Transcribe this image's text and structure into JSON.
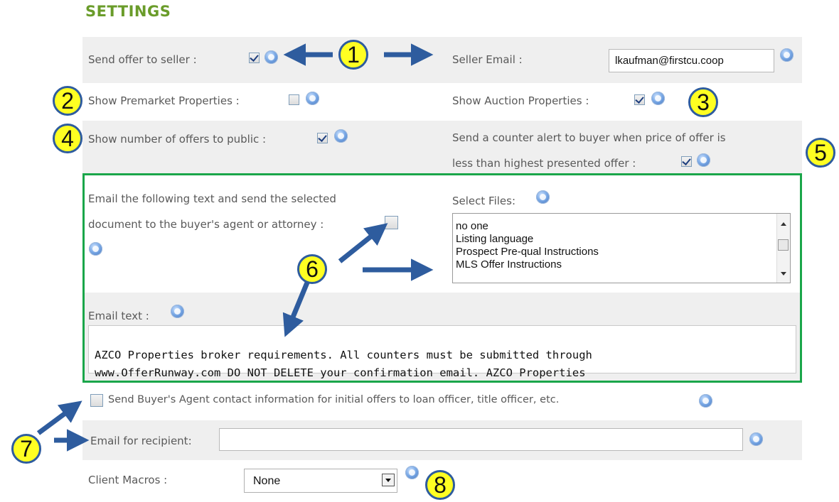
{
  "title": "SETTINGS",
  "send_offer": {
    "label": "Send offer to seller :",
    "checked": true
  },
  "seller_email": {
    "label": "Seller Email :",
    "value": "lkaufman@firstcu.coop"
  },
  "premarket": {
    "label": "Show Premarket Properties :",
    "checked": false
  },
  "auction": {
    "label": "Show Auction Properties :",
    "checked": true
  },
  "num_offers": {
    "label": "Show number of offers to public :",
    "checked": true
  },
  "counter_alert": {
    "label_line1": "Send a counter alert to buyer when price of offer is",
    "label_line2": "less than highest presented offer :",
    "checked": true
  },
  "email_doc": {
    "label_line1": "Email the following text and send the selected",
    "label_line2": "document to the buyer's agent or attorney :",
    "checked": false
  },
  "select_files": {
    "label": "Select Files:",
    "options": [
      "no one",
      "Listing language",
      "Prospect Pre-qual Instructions",
      "MLS Offer Instructions"
    ]
  },
  "email_text": {
    "label": "Email text :",
    "line1": "AZCO Properties broker requirements. All counters must be submitted through",
    "line2": "www.OfferRunway.com DO NOT DELETE your confirmation email. AZCO Properties"
  },
  "send_buyer_agent": {
    "label": "Send Buyer's Agent contact information for initial offers to loan officer, title officer, etc.",
    "checked": false
  },
  "recipient": {
    "label": "Email for recipient:",
    "value": ""
  },
  "client_macros": {
    "label": "Client Macros :",
    "selected": "None"
  },
  "badges": [
    "1",
    "2",
    "3",
    "4",
    "5",
    "6",
    "7",
    "8"
  ],
  "icons": {
    "help": "help-icon",
    "arrow": "arrow-icon"
  },
  "colors": {
    "title": "#6a9c2a",
    "row_bg": "#efefef",
    "highlight_border": "#1aa64a",
    "badge_fill": "#ffff22",
    "badge_border": "#2e5c9e",
    "arrow": "#2e5c9e"
  }
}
